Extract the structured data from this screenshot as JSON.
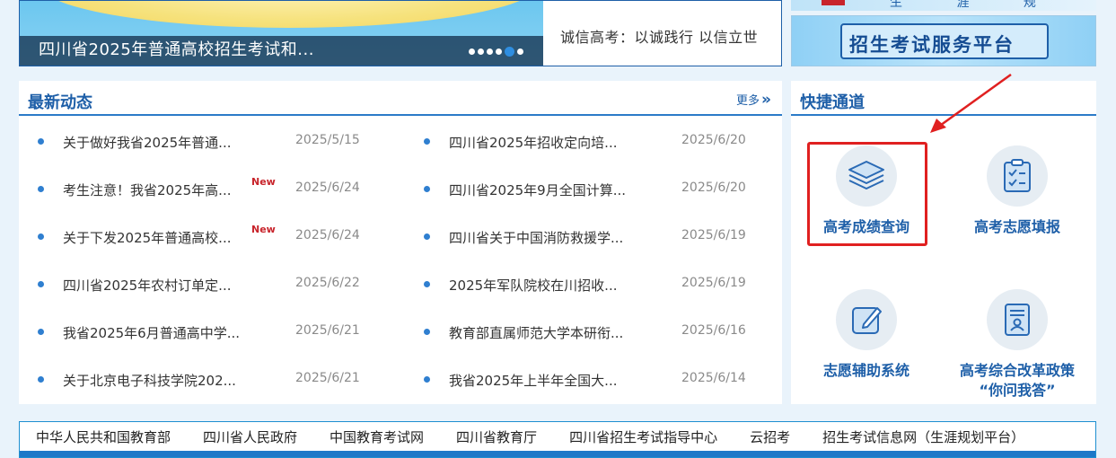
{
  "banner": {
    "caption": "四川省2025年普通高校招生考试和...",
    "slogan": "诚信高考：以诚践行 以信立世",
    "slide_count": 6,
    "active_slide": 5
  },
  "right_banners": {
    "top_text": "生 涯 规 划 平 台",
    "service_platform": "招生考试服务平台"
  },
  "news": {
    "title": "最新动态",
    "more": "更多",
    "left": [
      {
        "title": "关于做好我省2025年普通...",
        "date": "2025/5/15",
        "new": ""
      },
      {
        "title": "考生注意！我省2025年高...",
        "date": "2025/6/24",
        "new": "New"
      },
      {
        "title": "关于下发2025年普通高校...",
        "date": "2025/6/24",
        "new": "New"
      },
      {
        "title": "四川省2025年农村订单定...",
        "date": "2025/6/22",
        "new": ""
      },
      {
        "title": "我省2025年6月普通高中学...",
        "date": "2025/6/21",
        "new": ""
      },
      {
        "title": "关于北京电子科技学院202...",
        "date": "2025/6/21",
        "new": ""
      }
    ],
    "right": [
      {
        "title": "四川省2025年招收定向培...",
        "date": "2025/6/20"
      },
      {
        "title": "四川省2025年9月全国计算...",
        "date": "2025/6/20"
      },
      {
        "title": "四川省关于中国消防救援学...",
        "date": "2025/6/19"
      },
      {
        "title": "2025年军队院校在川招收...",
        "date": "2025/6/19"
      },
      {
        "title": "教育部直属师范大学本研衔...",
        "date": "2025/6/16"
      },
      {
        "title": "我省2025年上半年全国大...",
        "date": "2025/6/14"
      }
    ]
  },
  "quick": {
    "title": "快捷通道",
    "items": [
      {
        "label": "高考成绩查询",
        "icon": "stack-layers-icon"
      },
      {
        "label": "高考志愿填报",
        "icon": "clipboard-check-icon"
      },
      {
        "label": "志愿辅助系统",
        "icon": "edit-pen-icon"
      },
      {
        "label": "高考综合改革政策",
        "label2": "“你问我答”",
        "icon": "document-user-icon"
      }
    ]
  },
  "links": [
    "中华人民共和国教育部",
    "四川省人民政府",
    "中国教育考试网",
    "四川省教育厅",
    "四川省招生考试指导中心",
    "云招考",
    "招生考试信息网（生涯规划平台）"
  ],
  "colors": {
    "brand_blue": "#1e5fa8",
    "bullet_blue": "#2f7fd0",
    "highlight_red": "#e02020",
    "new_red": "#c8242b",
    "page_bg": "#e9f3fb"
  }
}
